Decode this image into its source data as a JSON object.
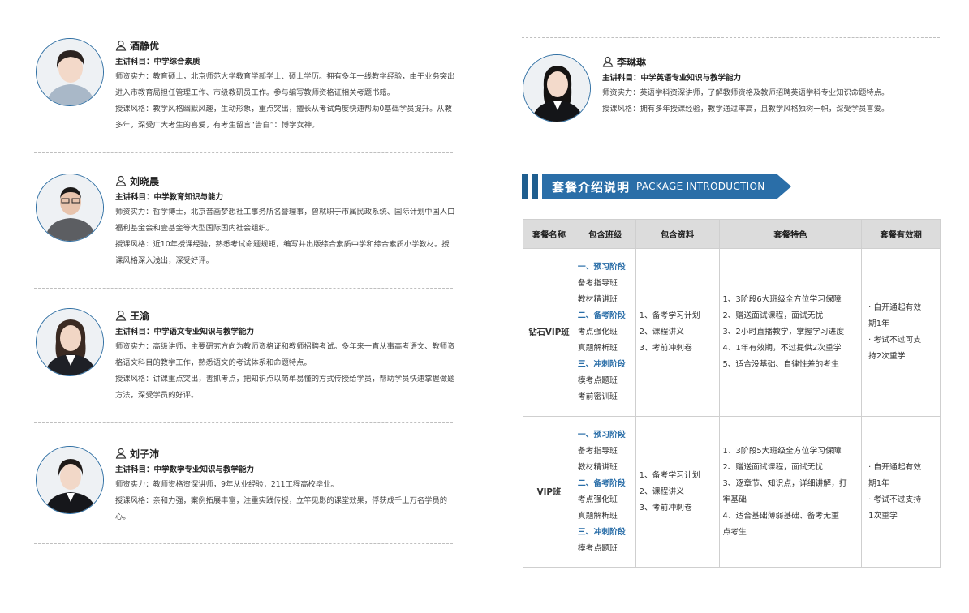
{
  "teachers": [
    {
      "name": "酒静优",
      "subject": "主讲科目：中学综合素质",
      "strength": "师资实力：教育硕士，北京师范大学教育学部学士、硕士学历。拥有多年一线教学经验，由于业务突出进入市教育局担任管理工作、市级教研员工作。参与编写教师资格证相关考题书籍。",
      "style": "授课风格：教学风格幽默风趣，生动形象，重点突出，擅长从考试角度快速帮助0基础学员提升。从教多年，深受广大考生的喜爱，有考生留言“告白”：博学女神。"
    },
    {
      "name": "刘晓晨",
      "subject": "主讲科目：中学教育知识与能力",
      "strength": "师资实力：哲学博士，北京音画梦想社工事务所名誉理事，曾就职于市属民政系统、国际计划中国人口福利基金会和壹基金等大型国际国内社会组织。",
      "style": "授课风格：近10年授课经验，熟悉考试命题规矩，编写并出版综合素质中学和综合素质小学教材。授课风格深入浅出，深受好评。"
    },
    {
      "name": "王渝",
      "subject": "主讲科目：中学语文专业知识与教学能力",
      "strength": "师资实力：高级讲师，主要研究方向为教师资格证和教师招聘考试。多年来一直从事高考语文、教师资格语文科目的教学工作，熟悉语文的考试体系和命题特点。",
      "style": "授课风格：讲课重点突出，善抓考点，把知识点以简单易懂的方式传授给学员，帮助学员快速掌握做题方法，深受学员的好评。"
    },
    {
      "name": "刘子沛",
      "subject": "主讲科目：中学数学专业知识与教学能力",
      "strength": "师资实力：教师资格资深讲师，9年从业经验，211工程高校毕业。",
      "style": "授课风格：亲和力强，案例拓展丰富，注重实践传授，立竿见影的课堂效果，俘获成千上万名学员的心。"
    },
    {
      "name": "李琳琳",
      "subject": "主讲科目：中学英语专业知识与教学能力",
      "strength": "师资实力：英语学科资深讲师，了解教师资格及教师招聘英语学科专业知识命题特点。",
      "style": "授课风格：拥有多年授课经验，教学通过率高，且教学风格独树一帜，深受学员喜爱。"
    }
  ],
  "package_section": {
    "title_cn": "套餐介绍说明",
    "title_en": "PACKAGE INTRODUCTION"
  },
  "package_table": {
    "headers": [
      "套餐名称",
      "包含班级",
      "包含资料",
      "套餐特色",
      "套餐有效期"
    ],
    "rows": [
      {
        "name": "钻石VIP班",
        "classes": [
          {
            "text": "一、预习阶段",
            "stage": true
          },
          {
            "text": "备考指导班",
            "stage": false
          },
          {
            "text": "教材精讲班",
            "stage": false
          },
          {
            "text": "二、备考阶段",
            "stage": true
          },
          {
            "text": "考点强化班",
            "stage": false
          },
          {
            "text": "真题解析班",
            "stage": false
          },
          {
            "text": "三、冲刺阶段",
            "stage": true
          },
          {
            "text": "模考点题班",
            "stage": false
          },
          {
            "text": "考前密训班",
            "stage": false
          }
        ],
        "materials": [
          "1、备考学习计划",
          "2、课程讲义",
          "3、考前冲刺卷"
        ],
        "features": [
          "1、3阶段6大班级全方位学习保障",
          "2、赠送面试课程，面试无忧",
          "3、2小时直播教学，掌握学习进度",
          "4、1年有效期，不过提供2次重学",
          "5、适合没基础、自律性差的考生"
        ],
        "validity": [
          "· 自开通起有效",
          "期1年",
          "· 考试不过可支",
          "持2次重学"
        ]
      },
      {
        "name": "VIP班",
        "classes": [
          {
            "text": "一、预习阶段",
            "stage": true
          },
          {
            "text": "备考指导班",
            "stage": false
          },
          {
            "text": "教材精讲班",
            "stage": false
          },
          {
            "text": "二、备考阶段",
            "stage": true
          },
          {
            "text": "考点强化班",
            "stage": false
          },
          {
            "text": "真题解析班",
            "stage": false
          },
          {
            "text": "三、冲刺阶段",
            "stage": true
          },
          {
            "text": "模考点题班",
            "stage": false
          }
        ],
        "materials": [
          "1、备考学习计划",
          "2、课程讲义",
          "3、考前冲刺卷"
        ],
        "features": [
          "1、3阶段5大班级全方位学习保障",
          "2、赠送面试课程，面试无忧",
          "3、逐章节、知识点，详细讲解，打",
          "牢基础",
          "4、适合基础薄弱基础、备考无重",
          "点考生"
        ],
        "validity": [
          "· 自开通起有效",
          "期1年",
          "· 考试不过支持",
          "1次重学"
        ]
      }
    ]
  },
  "colors": {
    "accent": "#2a6ea8",
    "dark_accent": "#1f5e8f",
    "header_bg": "#dcdcdc"
  }
}
